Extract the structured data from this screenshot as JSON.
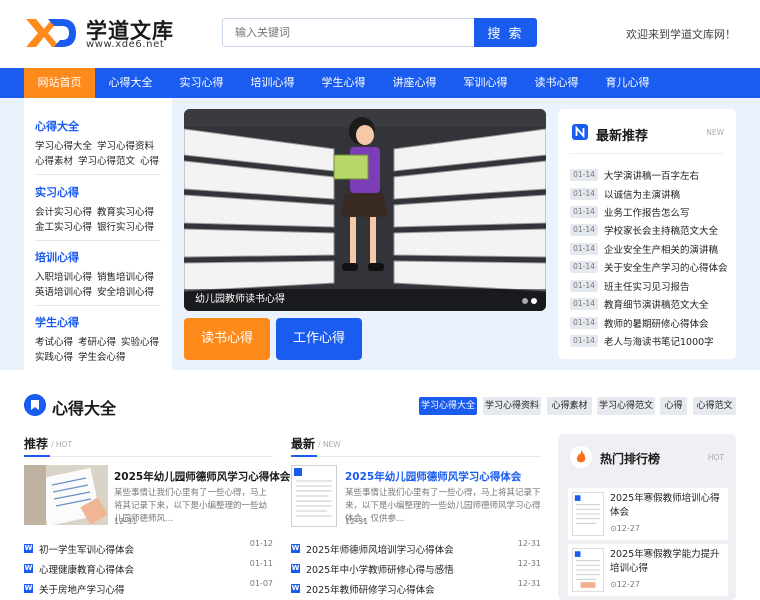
{
  "header": {
    "logo_name": "学道文库",
    "logo_url": "www.xde6.net",
    "search_placeholder": "输入关键词",
    "search_button": "搜 索",
    "welcome": "欢迎来到学道文库网！"
  },
  "nav": {
    "items": [
      "网站首页",
      "心得大全",
      "实习心得",
      "培训心得",
      "学生心得",
      "讲座心得",
      "军训心得",
      "读书心得",
      "育儿心得"
    ]
  },
  "sidebar": {
    "groups": [
      {
        "title": "心得大全",
        "rows": [
          [
            "学习心得大全",
            "学习心得资料"
          ],
          [
            "心得素材",
            "学习心得范文",
            "心得"
          ]
        ]
      },
      {
        "title": "实习心得",
        "rows": [
          [
            "会计实习心得",
            "教育实习心得"
          ],
          [
            "金工实习心得",
            "银行实习心得"
          ]
        ]
      },
      {
        "title": "培训心得",
        "rows": [
          [
            "入职培训心得",
            "销售培训心得"
          ],
          [
            "英语培训心得",
            "安全培训心得"
          ]
        ]
      },
      {
        "title": "学生心得",
        "rows": [
          [
            "考试心得",
            "考研心得",
            "实验心得"
          ],
          [
            "实践心得",
            "学生会心得"
          ]
        ]
      }
    ]
  },
  "banner": {
    "caption": "幼儿园教师读书心得"
  },
  "buttons": {
    "reading": "读书心得",
    "work": "工作心得"
  },
  "latest": {
    "title": "最新推荐",
    "badge": "NEW",
    "items": [
      {
        "date": "01-14",
        "text": "大学演讲稿一百字左右"
      },
      {
        "date": "01-14",
        "text": "以诚信为主演讲稿"
      },
      {
        "date": "01-14",
        "text": "业务工作报告怎么写"
      },
      {
        "date": "01-14",
        "text": "学校家长会主持稿范文大全"
      },
      {
        "date": "01-14",
        "text": "企业安全生产相关的演讲稿"
      },
      {
        "date": "01-14",
        "text": "关于安全生产学习的心得体会"
      },
      {
        "date": "01-14",
        "text": "班主任实习见习报告"
      },
      {
        "date": "01-14",
        "text": "教育细节演讲稿范文大全"
      },
      {
        "date": "01-14",
        "text": "教师的暑期研修心得体会"
      },
      {
        "date": "01-14",
        "text": "老人与海读书笔记1000字"
      }
    ]
  },
  "section": {
    "title": "心得大全",
    "tags": [
      "学习心得大全",
      "学习心得资料",
      "心得素材",
      "学习心得范文",
      "心得",
      "心得范文"
    ]
  },
  "recommend": {
    "title": "推荐",
    "sub": "/ HOT",
    "feature": {
      "title": "2025年幼儿园师德师风学习心得体会",
      "summary": "某些事情让我们心里有了一些心得，马上将其记录下来，以下是小编整理的一些幼儿园师德师风...",
      "date": "12-31"
    },
    "items": [
      {
        "text": "初一学生军训心得体会",
        "date": "01-12"
      },
      {
        "text": "心理健康教育心得体会",
        "date": "01-11"
      },
      {
        "text": "关于房地产学习心得",
        "date": "01-07"
      }
    ]
  },
  "newest": {
    "title": "最新",
    "sub": "/ NEW",
    "feature": {
      "title": "2025年幼儿园师德师风学习心得体会",
      "summary": "某些事情让我们心里有了一些心得，马上将其记录下来，以下是小编整理的一些幼儿园师德师风学习心得体会，仅供参...",
      "date": "12-31"
    },
    "items": [
      {
        "text": "2025年师德师风培训学习心得体会",
        "date": "12-31"
      },
      {
        "text": "2025年中小学教师研修心得与感悟",
        "date": "12-31"
      },
      {
        "text": "2025年教师研修学习心得体会",
        "date": "12-31"
      }
    ]
  },
  "hot": {
    "title": "热门排行榜",
    "sub": "HOT",
    "items": [
      {
        "text": "2025年寒假教师培训心得体会",
        "date": "12-27"
      },
      {
        "text": "2025年寒假教学能力提升培训心得",
        "date": "12-27"
      }
    ]
  },
  "colors": {
    "brand": "#1a5cf0",
    "accent": "#ff8a1c",
    "band": "#eaf2fe"
  },
  "icons": {
    "logo": "xd-logo-icon",
    "latest": "n-badge-icon",
    "section": "bookmark-icon",
    "hot": "flame-icon",
    "doc": "word-doc-icon"
  }
}
